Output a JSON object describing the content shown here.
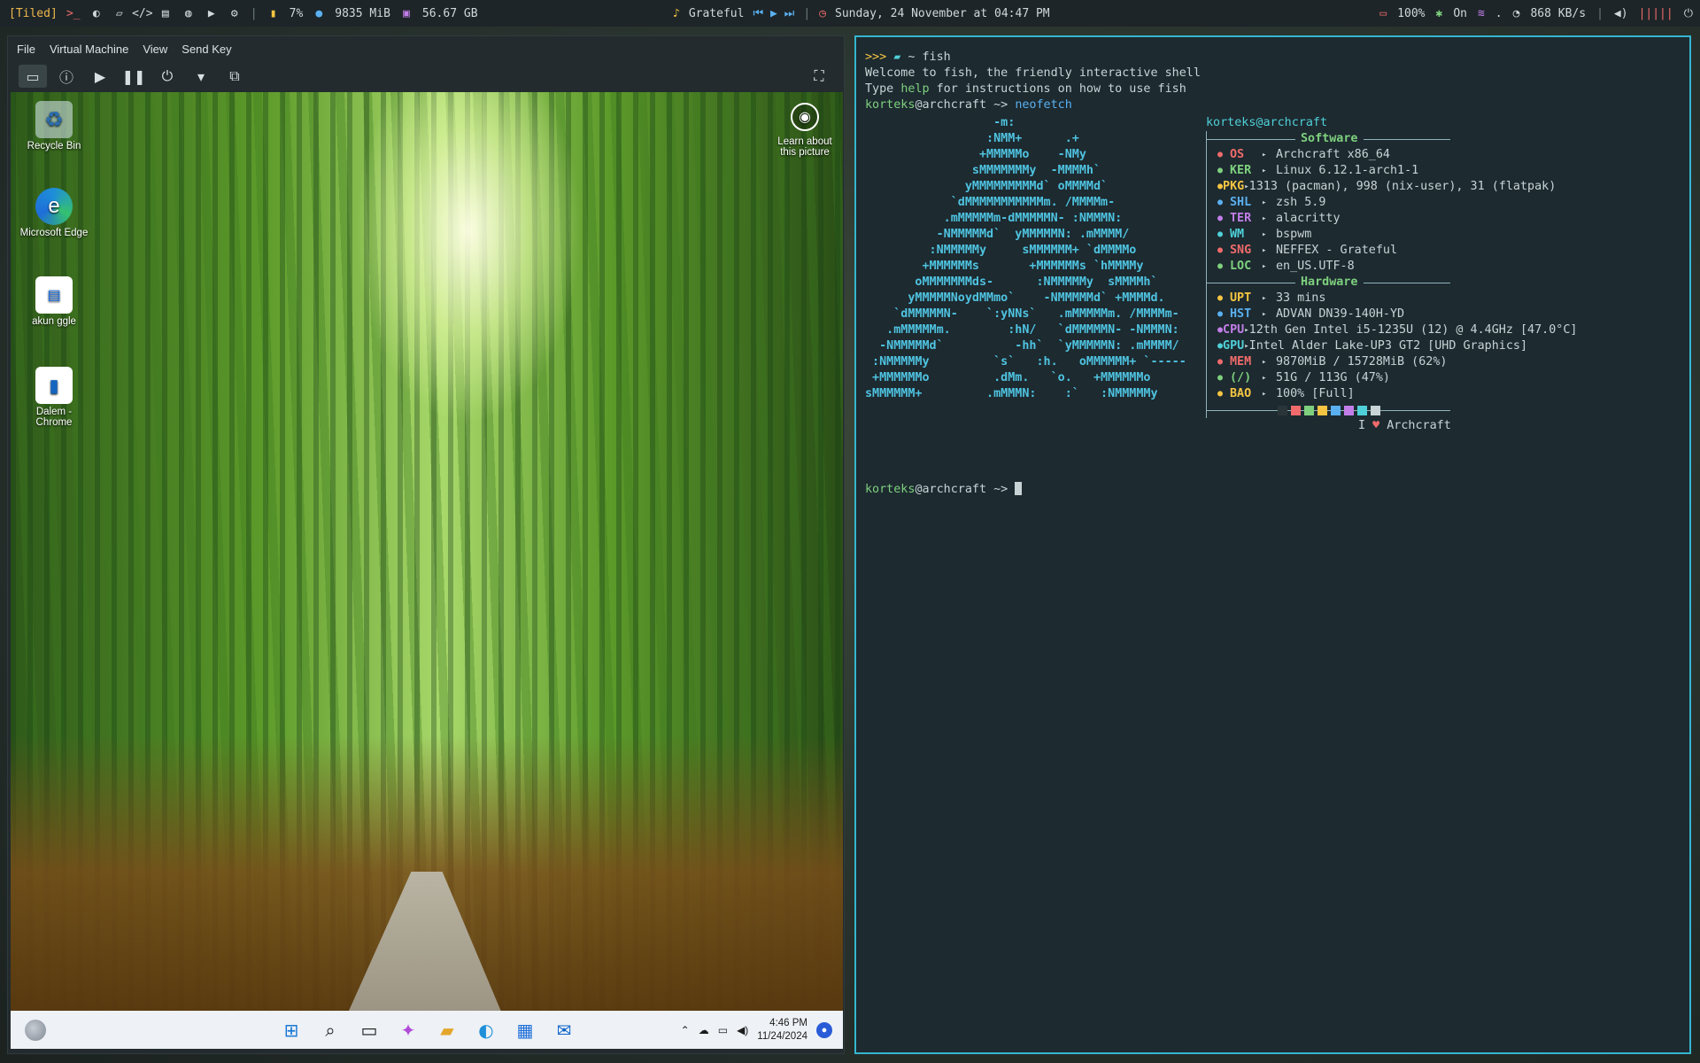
{
  "topbar": {
    "layout": "[Tiled]",
    "cpu": "7%",
    "ram": "9835 MiB",
    "disk": "56.67 GB",
    "song": "Grateful",
    "media_controls": "⏮ ▶ ⏭",
    "datetime": "Sunday, 24 November at 04:47 PM",
    "battery": "100%",
    "bluetooth": "On",
    "wifi_label": ".",
    "net_speed": "868 KB/s",
    "colors": {
      "bar_bg": "#1d2528",
      "accent": "#f0b84c"
    }
  },
  "vm": {
    "menu": [
      "File",
      "Virtual Machine",
      "View",
      "Send Key"
    ],
    "desktop_icons": [
      {
        "label": "Recycle Bin",
        "icon": "recycle-bin-icon"
      },
      {
        "label": "Microsoft Edge",
        "icon": "edge-icon"
      },
      {
        "label": "akun ggle",
        "icon": "document-icon"
      },
      {
        "label": "Dalem - Chrome",
        "icon": "document-icon"
      }
    ],
    "learn_label": "Learn about this picture",
    "taskbar": {
      "time": "4:46 PM",
      "date": "11/24/2024",
      "apps": [
        "start-icon",
        "search-icon",
        "taskview-icon",
        "copilot-icon",
        "file-explorer-icon",
        "edge-icon",
        "store-icon",
        "outlook-icon"
      ]
    }
  },
  "terminal": {
    "header": [
      {
        "prompt": ">>> ",
        "dir": "~",
        "cmd": "fish"
      }
    ],
    "welcome": "Welcome to fish, the friendly interactive shell",
    "help_pre": "Type ",
    "help_word": "help",
    "help_post": " for instructions on how to use fish",
    "user": "korteks",
    "host": "archcraft",
    "prompt_suffix": " ~> ",
    "command": "neofetch",
    "userhost": "korteks@archcraft",
    "software_title": "Software",
    "hardware_title": "Hardware",
    "software": [
      {
        "key": "OS",
        "val": "Archcraft x86_64",
        "color": "#f06b6b"
      },
      {
        "key": "KER",
        "val": "Linux 6.12.1-arch1-1",
        "color": "#7ed07e"
      },
      {
        "key": "PKG",
        "val": "1313 (pacman), 998 (nix-user), 31 (flatpak)",
        "color": "#f5c542"
      },
      {
        "key": "SHL",
        "val": "zsh 5.9",
        "color": "#5ab0f0"
      },
      {
        "key": "TER",
        "val": "alacritty",
        "color": "#c27ee8"
      },
      {
        "key": "WM",
        "val": "bspwm",
        "color": "#4fd0d8"
      },
      {
        "key": "SNG",
        "val": "NEFFEX - Grateful",
        "color": "#f06b6b"
      },
      {
        "key": "LOC",
        "val": "en_US.UTF-8",
        "color": "#7ed07e"
      }
    ],
    "hardware": [
      {
        "key": "UPT",
        "val": "33 mins",
        "color": "#f5c542"
      },
      {
        "key": "HST",
        "val": "ADVAN DN39-140H-YD",
        "color": "#5ab0f0"
      },
      {
        "key": "CPU",
        "val": "12th Gen Intel i5-1235U (12) @ 4.4GHz [47.0°C]",
        "color": "#c27ee8"
      },
      {
        "key": "GPU",
        "val": "Intel Alder Lake-UP3 GT2 [UHD Graphics]",
        "color": "#4fd0d8"
      },
      {
        "key": "MEM",
        "val": "9870MiB / 15728MiB (62%)",
        "color": "#f06b6b"
      },
      {
        "key": "(/)",
        "val": "51G / 113G (47%)",
        "color": "#7ed07e"
      },
      {
        "key": "BAO",
        "val": "100% [Full]",
        "color": "#f5c542"
      }
    ],
    "palette": [
      "#2a353a",
      "#f06b6b",
      "#7ed07e",
      "#f5c542",
      "#5ab0f0",
      "#c27ee8",
      "#4fd0d8",
      "#c8d3d5"
    ],
    "love_pre": "I ",
    "love_post": " Archcraft",
    "ascii": [
      "                  -m:",
      "                 :NMM+      .+",
      "                +MMMMMo    -NMy",
      "               sMMMMMMMy  -MMMMh`",
      "              yMMMMMMMMMd` oMMMMd`",
      "            `dMMMMMMMMMMMm. /MMMMm-",
      "           .mMMMMMm-dMMMMMN- :NMMMN:",
      "          -NMMMMMd`  yMMMMMN: .mMMMM/",
      "         :NMMMMMy     sMMMMMM+ `dMMMMo",
      "        +MMMMMMs       +MMMMMMs `hMMMMy",
      "       oMMMMMMMds-      :NMMMMMy  sMMMMh`",
      "      yMMMMMNoydMMmo`    -NMMMMMd` +MMMMd.",
      "    `dMMMMMN-    `:yNNs`   .mMMMMMm. /MMMMm-",
      "   .mMMMMMm.        :hN/   `dMMMMMN- -NMMMN:",
      "  -NMMMMMd`          -hh`  `yMMMMMN: .mMMMM/",
      " :NMMMMMy         `s`   :h.   oMMMMMM+ `-----",
      " +MMMMMMo         .dMm.   `o.   +MMMMMMo",
      "sMMMMMM+         .mMMMN:    :`   :NMMMMMy"
    ]
  }
}
